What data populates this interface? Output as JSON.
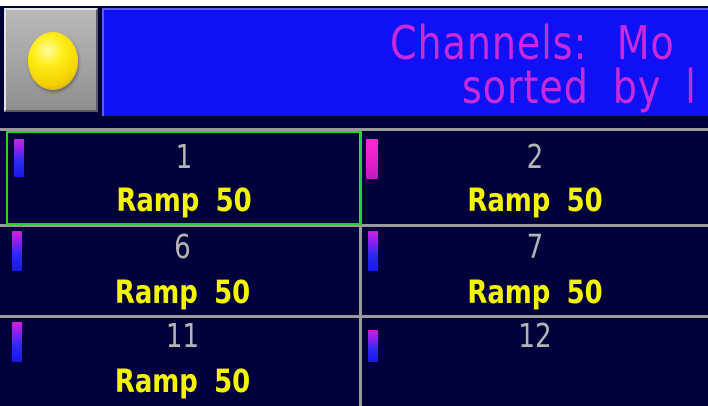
{
  "header": {
    "title_line1_word1": "Channels:",
    "title_line1_word2": "Mo",
    "title_line2_word1": "sorted",
    "title_line2_word2": "by",
    "title_line2_word3": "l",
    "status_lamp_icon": "yellow-status-lamp-icon",
    "colors": {
      "title_bg": "#1010f4",
      "title_text": "#c82adb",
      "lamp": "#ffee1a"
    }
  },
  "channels": [
    {
      "number": "1",
      "info": "Ramp 50",
      "selected": true,
      "level": "low"
    },
    {
      "number": "2",
      "info": "Ramp 50",
      "selected": false,
      "level": "high"
    },
    {
      "number": "6",
      "info": "Ramp 50",
      "selected": false,
      "level": "low"
    },
    {
      "number": "7",
      "info": "Ramp 50",
      "selected": false,
      "level": "low"
    },
    {
      "number": "11",
      "info": "Ramp 50",
      "selected": false,
      "level": "low"
    },
    {
      "number": "12",
      "info": "",
      "selected": false,
      "level": "low"
    }
  ],
  "colors": {
    "background": "#00003a",
    "channel_number": "#b4b4b4",
    "channel_info": "#f4f400",
    "selection_border": "#22d422",
    "grid_line": "#9a9a9a"
  }
}
